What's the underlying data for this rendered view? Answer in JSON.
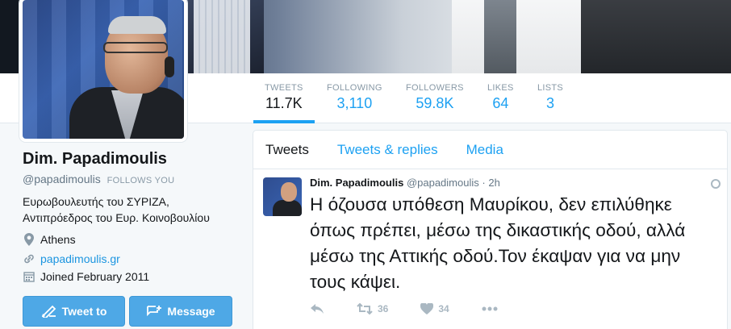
{
  "profile": {
    "name": "Dim. Papadimoulis",
    "handle": "@papadimoulis",
    "follows_you": "FOLLOWS YOU",
    "bio_line1": "Ευρωβουλευτής του ΣΥΡΙΖΑ,",
    "bio_line2": "Αντιπρόεδρος του Ευρ. Κοινοβουλίου",
    "location": "Athens",
    "website": "papadimoulis.gr",
    "joined": "Joined February 2011"
  },
  "stats": [
    {
      "label": "TWEETS",
      "value": "11.7K"
    },
    {
      "label": "FOLLOWING",
      "value": "3,110"
    },
    {
      "label": "FOLLOWERS",
      "value": "59.8K"
    },
    {
      "label": "LIKES",
      "value": "64"
    },
    {
      "label": "LISTS",
      "value": "3"
    }
  ],
  "buttons": {
    "tweet_to": "Tweet to",
    "message": "Message"
  },
  "timeline": {
    "tabs": [
      "Tweets",
      "Tweets & replies",
      "Media"
    ]
  },
  "tweet": {
    "author": "Dim. Papadimoulis",
    "handle": "@papadimoulis",
    "separator": "·",
    "time": "2h",
    "text": "Η όζουσα υπόθεση Μαυρίκου, δεν επιλύθηκε όπως πρέπει, μέσω της δικαστικής οδού, αλλά μέσω της Αττικής οδού.Τον έκαψαν για να μην τους κάψει.",
    "retweets": "36",
    "likes": "34"
  },
  "colors": {
    "accent": "#1da1f2",
    "button": "#4ea8e6",
    "link": "#1b95e0"
  }
}
